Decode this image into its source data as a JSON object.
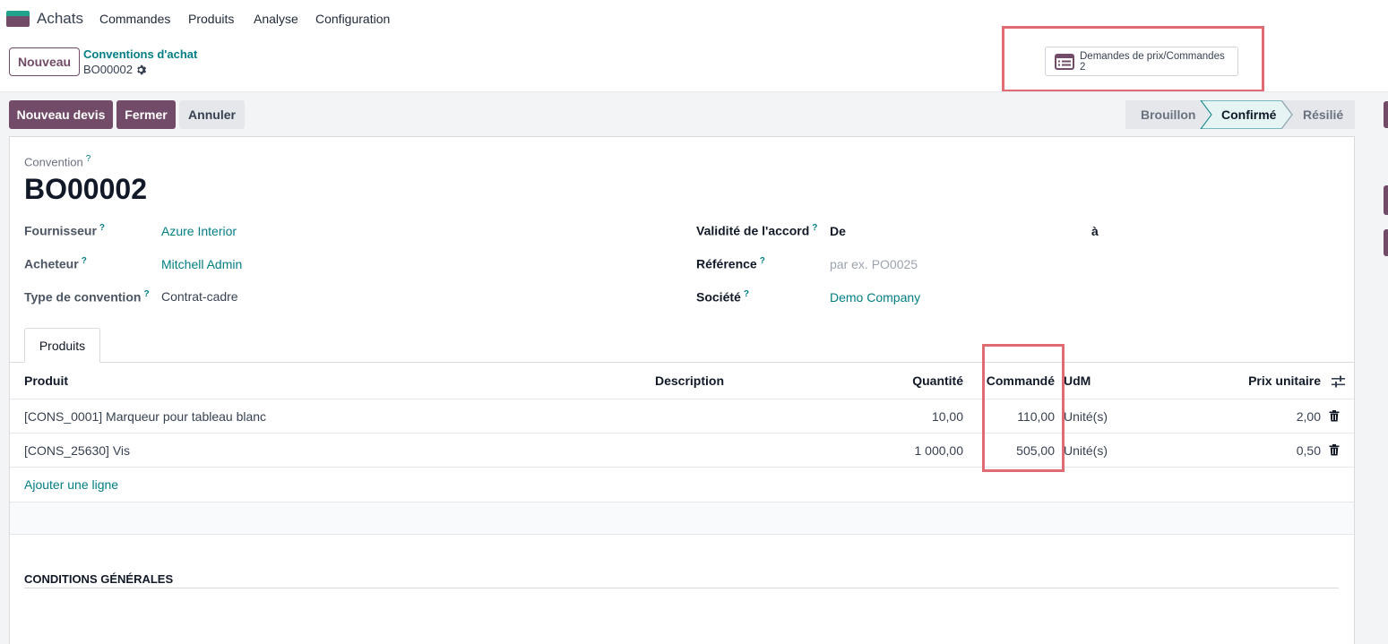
{
  "navbar": {
    "app_name": "Achats",
    "menu": [
      "Commandes",
      "Produits",
      "Analyse",
      "Configuration"
    ]
  },
  "control_panel": {
    "new_button": "Nouveau",
    "breadcrumb_parent": "Conventions d'achat",
    "breadcrumb_current": "BO00002",
    "smart_button": {
      "label": "Demandes de prix/Commandes",
      "count": "2",
      "icon": "list-icon"
    }
  },
  "actions": {
    "new_quote": "Nouveau devis",
    "close": "Fermer",
    "cancel": "Annuler"
  },
  "statusbar": {
    "stages": [
      "Brouillon",
      "Confirmé",
      "Résilié"
    ],
    "active": "Confirmé"
  },
  "form": {
    "convention_label": "Convention",
    "title": "BO00002",
    "help_mark": "?",
    "left_fields": [
      {
        "label": "Fournisseur",
        "value": "Azure Interior"
      },
      {
        "label": "Acheteur",
        "value": "Mitchell Admin"
      },
      {
        "label": "Type de convention",
        "value": "Contrat-cadre"
      }
    ],
    "validity": {
      "label": "Validité de l'accord",
      "from_label": "De",
      "to_label": "à"
    },
    "reference": {
      "label": "Référence",
      "placeholder": "par ex. PO0025"
    },
    "company": {
      "label": "Société",
      "value": "Demo Company"
    }
  },
  "notebook": {
    "tab": "Produits"
  },
  "table": {
    "headers": {
      "product": "Produit",
      "description": "Description",
      "quantity": "Quantité",
      "ordered": "Commandé",
      "uom": "UdM",
      "unit_price": "Prix unitaire"
    },
    "rows": [
      {
        "product": "[CONS_0001] Marqueur pour tableau blanc",
        "quantity": "10,00",
        "ordered": "110,00",
        "uom": "Unité(s)",
        "unit_price": "2,00"
      },
      {
        "product": "[CONS_25630] Vis",
        "quantity": "1 000,00",
        "ordered": "505,00",
        "uom": "Unité(s)",
        "unit_price": "0,50"
      }
    ],
    "add_line": "Ajouter une ligne"
  },
  "terms": {
    "title": "CONDITIONS GÉNÉRALES"
  },
  "colors": {
    "brand": "#714b67",
    "link": "#017e84",
    "highlight": "#e06b72"
  }
}
